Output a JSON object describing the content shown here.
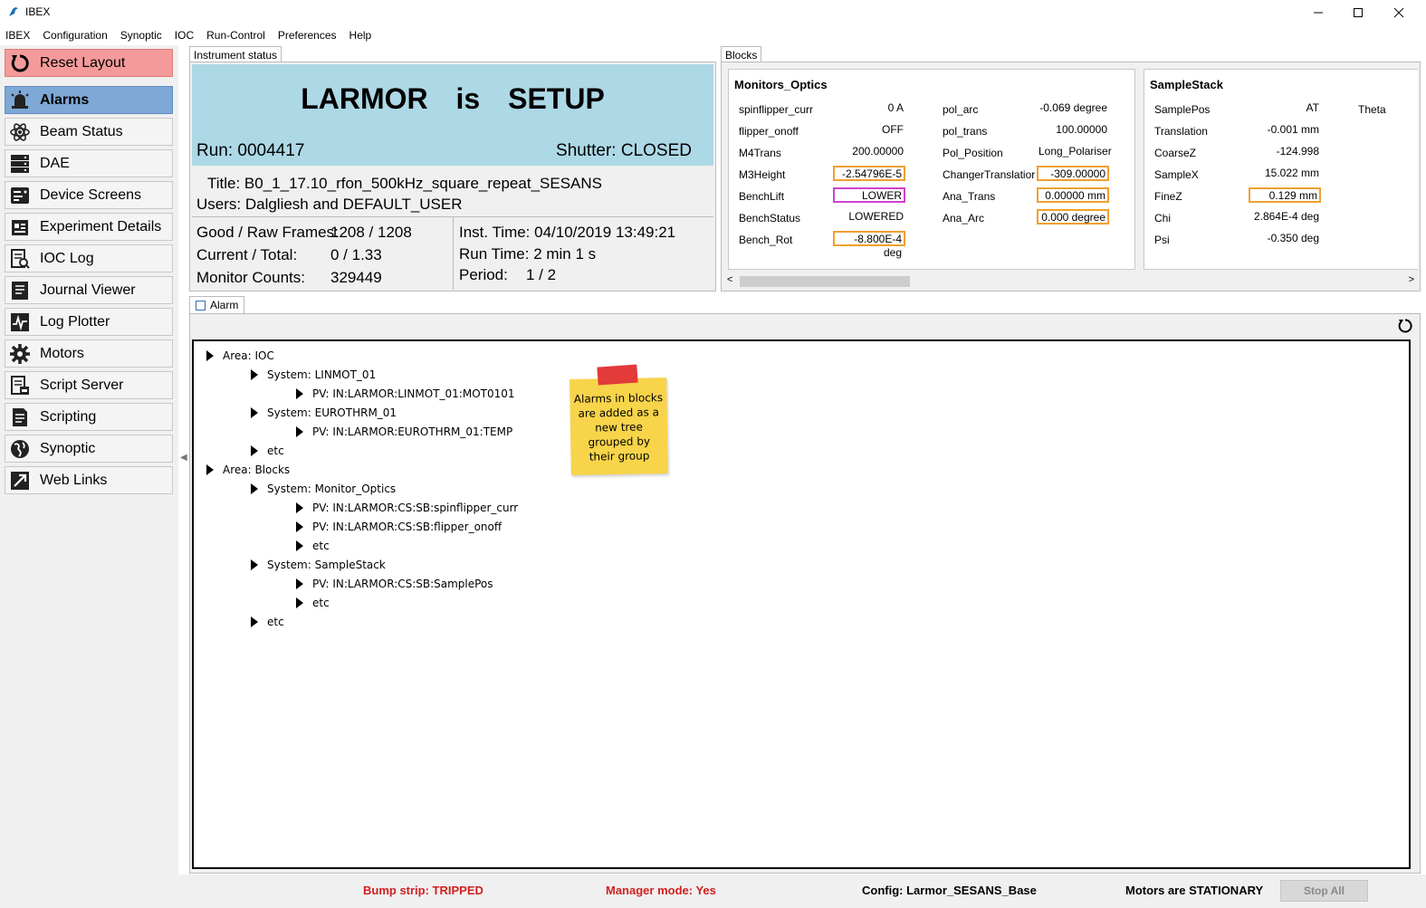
{
  "window": {
    "title": "IBEX"
  },
  "menu": [
    "IBEX",
    "Configuration",
    "Synoptic",
    "IOC",
    "Run-Control",
    "Preferences",
    "Help"
  ],
  "nav": {
    "reset_layout": "Reset Layout",
    "alarms": "Alarms",
    "items": [
      "Beam Status",
      "DAE",
      "Device Screens",
      "Experiment Details",
      "IOC Log",
      "Journal Viewer",
      "Log Plotter",
      "Motors",
      "Script Server",
      "Scripting",
      "Synoptic",
      "Web Links"
    ]
  },
  "instrument": {
    "tab_label": "Instrument status",
    "name": "LARMOR",
    "is_word": "is",
    "state": "SETUP",
    "run": "Run: 0004417",
    "shutter": "Shutter: CLOSED",
    "title": "Title: B0_1_17.10_rfon_500kHz_square_repeat_SESANS",
    "users": "Users: Dalgliesh and DEFAULT_USER",
    "frames_label": "Good / Raw Frames:",
    "frames_value": "1208 / 1208",
    "current_label": "Current / Total:",
    "current_value": "0 / 1.33",
    "monitor_label": "Monitor Counts:",
    "monitor_value": "329449",
    "inst_time": "Inst. Time: 04/10/2019 13:49:21",
    "run_time": "Run Time: 2 min 1 s",
    "period_label": "Period:",
    "period_value": "1 / 2"
  },
  "blocks": {
    "tab_label": "Blocks",
    "groups": [
      {
        "title": "Monitors_Optics",
        "col1": [
          {
            "name": "spinflipper_curr",
            "value": "0 A"
          },
          {
            "name": "flipper_onoff",
            "value": "OFF"
          },
          {
            "name": "M4Trans",
            "value": "200.00000"
          },
          {
            "name": "M3Height",
            "value": "-2.54796E-5"
          },
          {
            "name": "BenchLift",
            "value": "LOWER"
          },
          {
            "name": "BenchStatus",
            "value": "LOWERED"
          },
          {
            "name": "Bench_Rot",
            "value": "-8.800E-4 deg"
          }
        ],
        "col2": [
          {
            "name": "pol_arc",
            "value": "-0.069 degree"
          },
          {
            "name": "pol_trans",
            "value": "100.00000"
          },
          {
            "name": "Pol_Position",
            "value": "Long_Polariser"
          },
          {
            "name": "ChangerTranslatior",
            "value": "-309.00000"
          },
          {
            "name": "Ana_Trans",
            "value": "0.00000 mm"
          },
          {
            "name": "Ana_Arc",
            "value": "0.000 degree"
          }
        ]
      },
      {
        "title": "SampleStack",
        "col1": [
          {
            "name": "SamplePos",
            "value": "AT"
          },
          {
            "name": "Translation",
            "value": "-0.001 mm"
          },
          {
            "name": "CoarseZ",
            "value": "-124.998"
          },
          {
            "name": "SampleX",
            "value": "15.022 mm"
          },
          {
            "name": "FineZ",
            "value": "0.129 mm"
          },
          {
            "name": "Chi",
            "value": "2.864E-4 deg"
          },
          {
            "name": "Psi",
            "value": "-0.350 deg"
          }
        ],
        "col2": [
          {
            "name": "Theta",
            "value": ""
          }
        ]
      }
    ]
  },
  "alarm": {
    "tab_label": "Alarm",
    "tree": [
      "Area: IOC",
      "System: LINMOT_01",
      "PV: IN:LARMOR:LINMOT_01:MOT0101",
      "System: EUROTHRM_01",
      "PV: IN:LARMOR:EUROTHRM_01:TEMP",
      "etc",
      "Area: Blocks",
      "System: Monitor_Optics",
      "PV: IN:LARMOR:CS:SB:spinflipper_curr",
      "PV: IN:LARMOR:CS:SB:flipper_onoff",
      "etc",
      "System: SampleStack",
      "PV: IN:LARMOR:CS:SB:SamplePos",
      "etc",
      "etc"
    ],
    "note": "Alarms in blocks are added as a new tree grouped by their group"
  },
  "status": {
    "bump_strip": "Bump strip: TRIPPED",
    "manager_mode": "Manager mode: Yes",
    "config": "Config: Larmor_SESANS_Base",
    "motors": "Motors are STATIONARY",
    "stop_all": "Stop All"
  },
  "colors": {
    "reset": "#f59a9a",
    "alarms_selected": "#7ea8d6",
    "instrument_header": "#add8e6",
    "status_red": "#d02020",
    "block_alarm": "#f0a030",
    "block_magenta": "#d040d0"
  }
}
